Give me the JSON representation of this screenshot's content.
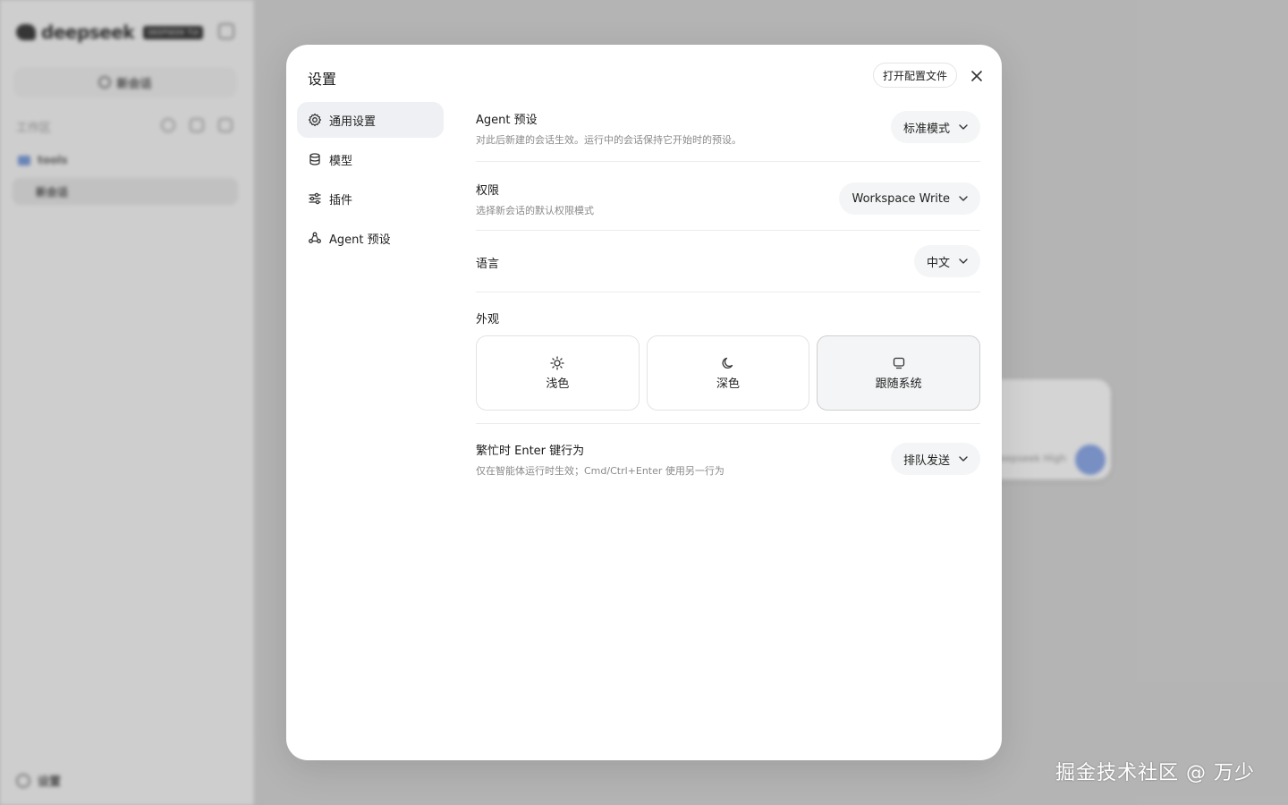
{
  "background": {
    "brand": "deepseek",
    "badge": "DEEPSEEK TUI",
    "new_chat_label": "新会话",
    "workspace_label": "工作区",
    "folder_label": "tools",
    "chat_item_label": "新会话",
    "settings_label": "设置",
    "model_label": "deepseek  High"
  },
  "modal": {
    "title": "设置",
    "open_config_label": "打开配置文件",
    "close_icon": "close-icon"
  },
  "nav": {
    "items": [
      {
        "label": "通用设置",
        "icon": "gear-icon",
        "active": true
      },
      {
        "label": "模型",
        "icon": "database-icon",
        "active": false
      },
      {
        "label": "插件",
        "icon": "sliders-icon",
        "active": false
      },
      {
        "label": "Agent 预设",
        "icon": "agent-icon",
        "active": false
      }
    ]
  },
  "settings": {
    "agent_preset": {
      "title": "Agent 预设",
      "desc": "对此后新建的会话生效。运行中的会话保持它开始时的预设。",
      "value": "标准模式"
    },
    "permission": {
      "title": "权限",
      "desc": "选择新会话的默认权限模式",
      "value": "Workspace Write"
    },
    "language": {
      "title": "语言",
      "value": "中文"
    },
    "appearance": {
      "title": "外观",
      "options": [
        {
          "label": "浅色",
          "icon": "sun-icon",
          "selected": false
        },
        {
          "label": "深色",
          "icon": "moon-icon",
          "selected": false
        },
        {
          "label": "跟随系统",
          "icon": "monitor-icon",
          "selected": true
        }
      ]
    },
    "enter_behavior": {
      "title": "繁忙时 Enter 键行为",
      "desc": "仅在智能体运行时生效；Cmd/Ctrl+Enter 使用另一行为",
      "value": "排队发送"
    }
  },
  "watermark": "掘金技术社区 @ 万少",
  "colors": {
    "accent_selected_bg": "#f4f5f6",
    "nav_active_bg": "#eef0f3",
    "desc_text": "#8a8a8a"
  }
}
